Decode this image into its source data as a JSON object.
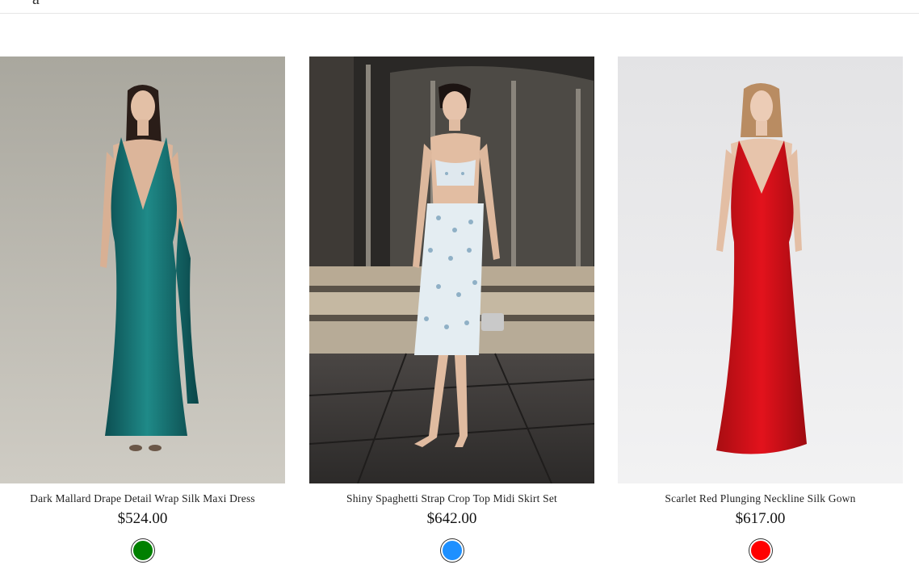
{
  "header": {
    "partial_glyph": "a"
  },
  "products": [
    {
      "name": "Dark Mallard Drape Detail Wrap Silk Maxi Dress",
      "price": "$524.00",
      "swatch_color": "#008000",
      "image_subject": "teal-silk-halter-maxi-dress"
    },
    {
      "name": "Shiny Spaghetti Strap Crop Top Midi Skirt Set",
      "price": "$642.00",
      "swatch_color": "#1e90ff",
      "image_subject": "sequin-crop-top-midi-skirt-set"
    },
    {
      "name": "Scarlet Red Plunging Neckline Silk Gown",
      "price": "$617.00",
      "swatch_color": "#ff0000",
      "image_subject": "red-silk-halter-gown"
    }
  ]
}
